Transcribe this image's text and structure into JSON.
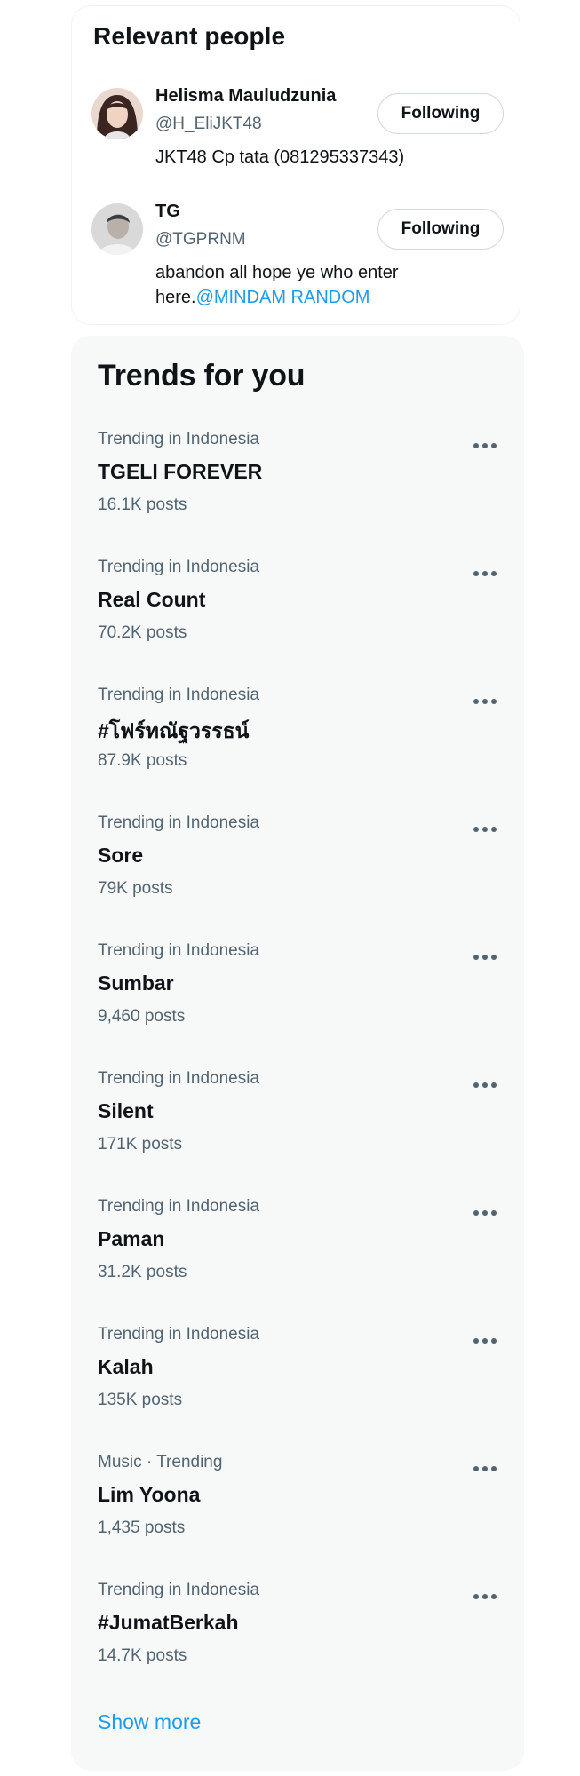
{
  "relevant_people": {
    "title": "Relevant people",
    "people": [
      {
        "name": "Helisma Mauludzunia",
        "handle": "@H_EliJKT48",
        "bio": "JKT48 Cp tata (081295337343)",
        "bio_mention": "",
        "follow_label": "Following"
      },
      {
        "name": "TG",
        "handle": "@TGPRNM",
        "bio": "abandon all hope ye who enter here.",
        "bio_mention": "@MINDAM RANDOM",
        "follow_label": "Following"
      }
    ]
  },
  "trends": {
    "title": "Trends for you",
    "items": [
      {
        "context": "Trending in Indonesia",
        "name": "TGELI FOREVER",
        "count": "16.1K posts"
      },
      {
        "context": "Trending in Indonesia",
        "name": "Real Count",
        "count": "70.2K posts"
      },
      {
        "context": "Trending in Indonesia",
        "name": "#โฟร์ทณัฐวรรธน์",
        "count": "87.9K posts"
      },
      {
        "context": "Trending in Indonesia",
        "name": "Sore",
        "count": "79K posts"
      },
      {
        "context": "Trending in Indonesia",
        "name": "Sumbar",
        "count": "9,460 posts"
      },
      {
        "context": "Trending in Indonesia",
        "name": "Silent",
        "count": "171K posts"
      },
      {
        "context": "Trending in Indonesia",
        "name": "Paman",
        "count": "31.2K posts"
      },
      {
        "context": "Trending in Indonesia",
        "name": "Kalah",
        "count": "135K posts"
      },
      {
        "context": "Music · Trending",
        "name": "Lim Yoona",
        "count": "1,435 posts"
      },
      {
        "context": "Trending in Indonesia",
        "name": "#JumatBerkah",
        "count": "14.7K posts"
      }
    ],
    "show_more": "Show more"
  },
  "icons": {
    "more": "more-horizontal-icon"
  },
  "colors": {
    "accent": "#1d9bf0",
    "text_primary": "#0f1419",
    "text_secondary": "#536471",
    "trends_background": "#f7f9f9"
  }
}
